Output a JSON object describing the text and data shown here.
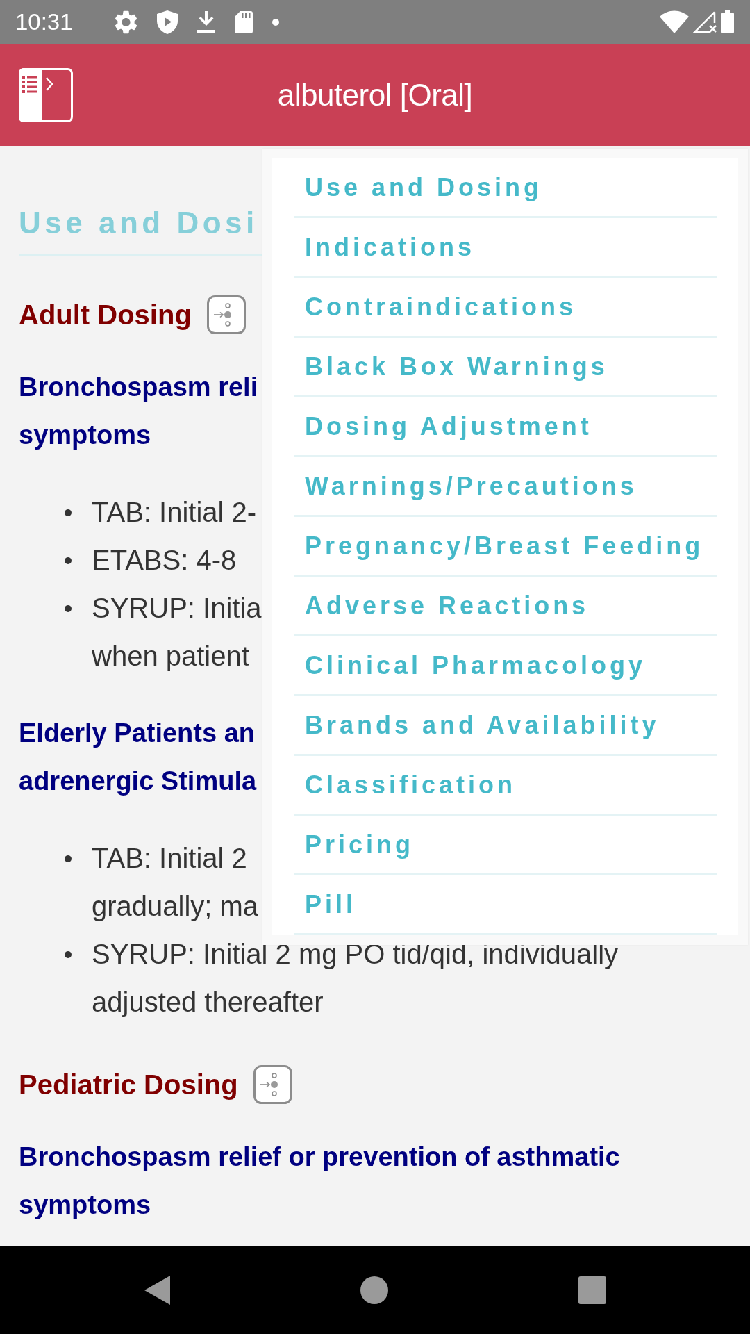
{
  "status_bar": {
    "time": "10:31"
  },
  "header": {
    "title": "albuterol [Oral]"
  },
  "content": {
    "section_title": "Use and Dosi",
    "blocks": [
      {
        "kind": "group_heading",
        "text": "Adult Dosing"
      },
      {
        "kind": "indication",
        "lines": [
          "Bronchospasm reli",
          "symptoms"
        ]
      },
      {
        "kind": "bullets",
        "items": [
          {
            "lines": [
              "TAB: Initial 2-"
            ]
          },
          {
            "lines": [
              "ETABS: 4-8"
            ]
          },
          {
            "lines": [
              "SYRUP: Initia",
              "when patient"
            ]
          }
        ]
      },
      {
        "kind": "indication",
        "lines": [
          "Elderly Patients an",
          "adrenergic Stimula"
        ]
      },
      {
        "kind": "bullets",
        "items": [
          {
            "lines": [
              "TAB: Initial 2",
              "gradually; ma"
            ]
          },
          {
            "lines": [
              "SYRUP: Initial 2 mg PO tid/qid, individually",
              "adjusted thereafter"
            ]
          }
        ]
      },
      {
        "kind": "group_heading",
        "text": "Pediatric Dosing"
      },
      {
        "kind": "indication",
        "lines": [
          "Bronchospasm relief or prevention of asthmatic",
          "symptoms"
        ]
      }
    ]
  },
  "section_menu": {
    "items": [
      {
        "label": "Use and Dosing"
      },
      {
        "label": "Indications"
      },
      {
        "label": "Contraindications"
      },
      {
        "label": "Black Box Warnings"
      },
      {
        "label": "Dosing Adjustment"
      },
      {
        "label": "Warnings/Precautions"
      },
      {
        "label": "Pregnancy/Breast Feeding"
      },
      {
        "label": "Adverse Reactions"
      },
      {
        "label": "Clinical Pharmacology"
      },
      {
        "label": "Brands and Availability"
      },
      {
        "label": "Classification"
      },
      {
        "label": "Pricing"
      },
      {
        "label": "Pill"
      }
    ]
  }
}
